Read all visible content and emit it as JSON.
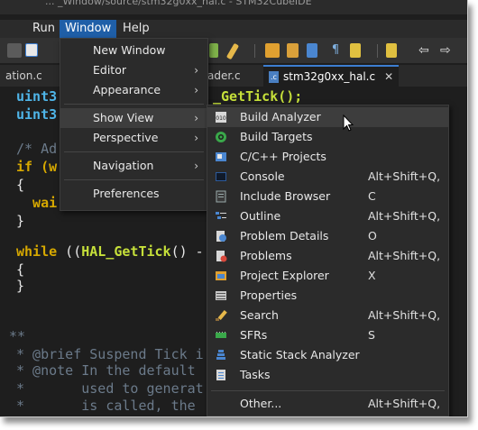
{
  "window_title": "... _Window/source/stm32g0xx_hal.c - STM32CubeIDE",
  "menubar": [
    {
      "label": "Run",
      "active": false
    },
    {
      "label": "Window",
      "active": true
    },
    {
      "label": "Help",
      "active": false
    }
  ],
  "tabs": [
    {
      "label": "ation.c",
      "active": false
    },
    {
      "label": "ader.c",
      "active": false
    },
    {
      "label": "stm32g0xx_hal.c",
      "active": true
    }
  ],
  "code_lines": [
    {
      "text": "uint3",
      "kind": "type"
    },
    {
      "text": "uint3",
      "kind": "type"
    },
    {
      "text": "/* Ad",
      "kind": "comment"
    },
    {
      "text": "if (w",
      "kind": "if"
    },
    {
      "text": "{",
      "kind": "punct"
    },
    {
      "text": "  wai",
      "kind": "wait"
    },
    {
      "text": "}",
      "kind": "punct"
    },
    {
      "text": "while ((HAL_GetTick() -",
      "kind": "while"
    },
    {
      "text": "{",
      "kind": "punct"
    },
    {
      "text": "}",
      "kind": "punct"
    },
    {
      "text": "**",
      "kind": "comment"
    },
    {
      "text": "* @brief Suspend Tick i",
      "kind": "comment"
    },
    {
      "text": "* @note In the default ",
      "kind": "comment"
    },
    {
      "text": "*       used to generat",
      "kind": "comment"
    },
    {
      "text": "*       is called, the ",
      "kind": "comment"
    },
    {
      "text": "*       ",
      "kind": "comment"
    }
  ],
  "code_fragment_right": "_GetTick();",
  "window_menu": {
    "items": [
      {
        "label": "New Window",
        "submenu": false
      },
      {
        "label": "Editor",
        "submenu": true
      },
      {
        "label": "Appearance",
        "submenu": true
      },
      {
        "label": "Show View",
        "submenu": true,
        "hover": true
      },
      {
        "label": "Perspective",
        "submenu": true
      },
      {
        "label": "Navigation",
        "submenu": true
      },
      {
        "label": "Preferences",
        "submenu": false
      }
    ],
    "arrow_glyph": "›"
  },
  "show_view_menu": {
    "items": [
      {
        "label": "Build Analyzer",
        "shortcut": "",
        "icon": "build-analyzer-icon",
        "hover": true
      },
      {
        "label": "Build Targets",
        "shortcut": "",
        "icon": "build-targets-icon"
      },
      {
        "label": "C/C++ Projects",
        "shortcut": "",
        "icon": "cpp-projects-icon"
      },
      {
        "label": "Console",
        "shortcut": "Alt+Shift+Q, C",
        "icon": "console-icon"
      },
      {
        "label": "Include Browser",
        "shortcut": "",
        "icon": "include-browser-icon"
      },
      {
        "label": "Outline",
        "shortcut": "Alt+Shift+Q, O",
        "icon": "outline-icon"
      },
      {
        "label": "Problem Details",
        "shortcut": "",
        "icon": "problem-details-icon"
      },
      {
        "label": "Problems",
        "shortcut": "Alt+Shift+Q, X",
        "icon": "problems-icon"
      },
      {
        "label": "Project Explorer",
        "shortcut": "",
        "icon": "project-explorer-icon"
      },
      {
        "label": "Properties",
        "shortcut": "",
        "icon": "properties-icon"
      },
      {
        "label": "Search",
        "shortcut": "Alt+Shift+Q, S",
        "icon": "search-icon"
      },
      {
        "label": "SFRs",
        "shortcut": "",
        "icon": "sfrs-icon"
      },
      {
        "label": "Static Stack Analyzer",
        "shortcut": "",
        "icon": "static-stack-analyzer-icon"
      },
      {
        "label": "Tasks",
        "shortcut": "",
        "icon": "tasks-icon"
      },
      {
        "label": "Other...",
        "shortcut": "Alt+Shift+Q, Q",
        "icon": ""
      }
    ]
  },
  "colors": {
    "accent": "#1f5fa8",
    "background": "#1e1e1e",
    "menu_bg": "#2b2b2b",
    "keyword": "#d6a800",
    "type": "#4fb5e8",
    "function": "#c6e03a",
    "comment": "#6b7a8a"
  }
}
